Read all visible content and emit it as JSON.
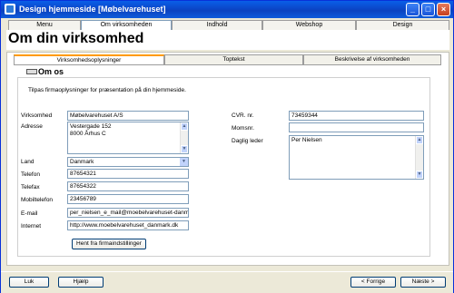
{
  "window": {
    "title": "Design hjemmeside [Møbelvarehuset]"
  },
  "topnav": {
    "tabs": [
      {
        "label": "Menu"
      },
      {
        "label": "Om virksomheden"
      },
      {
        "label": "Indhold"
      },
      {
        "label": "Webshop"
      },
      {
        "label": "Design"
      }
    ]
  },
  "page": {
    "title": "Om din virksomhed"
  },
  "subtabs": [
    {
      "label": "Virksomhedsoplysninger"
    },
    {
      "label": "Toptekst"
    },
    {
      "label": "Beskrivelse af virksomheden"
    }
  ],
  "section": {
    "title": "Om os",
    "description": "Tilpas firmaoplysninger for præsentation på din hjemmeside."
  },
  "form": {
    "virksomhed": {
      "label": "Virksomhed",
      "value": "Møbelvarehuset A/S"
    },
    "adresse": {
      "label": "Adresse",
      "line1": "Vestergade 152",
      "line2": "8000 Århus C"
    },
    "land": {
      "label": "Land",
      "value": "Danmark"
    },
    "telefon": {
      "label": "Telefon",
      "value": "87654321"
    },
    "telefax": {
      "label": "Telefax",
      "value": "87654322"
    },
    "mobiltelefon": {
      "label": "Mobiltelefon",
      "value": "23456789"
    },
    "email": {
      "label": "E-mail",
      "value": "per_nielsen_e_mail@moebelvarehuset-danmark.dk"
    },
    "internet": {
      "label": "Internet",
      "value": "http://www.moebelvarehuset_danmark.dk"
    },
    "cvr": {
      "label": "CVR. nr.",
      "value": "73459344"
    },
    "momsnr": {
      "label": "Momsnr.",
      "value": ""
    },
    "daglig_leder": {
      "label": "Daglig leder",
      "value": "Per Nielsen"
    },
    "fetch_button": "Hent fra firmaindstillinger"
  },
  "footer": {
    "luk": "Luk",
    "hjaelp": "Hjælp",
    "forrige": "< Forrige",
    "naeste": "Næste >"
  }
}
